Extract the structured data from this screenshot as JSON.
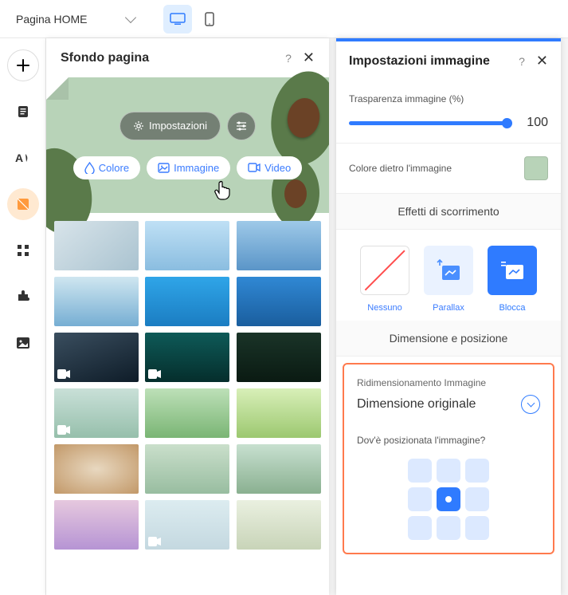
{
  "topbar": {
    "page_name": "Pagina HOME"
  },
  "bg_panel": {
    "title": "Sfondo pagina",
    "settings_btn": "Impostazioni",
    "tabs": {
      "color": "Colore",
      "image": "Immagine",
      "video": "Video"
    }
  },
  "settings_panel": {
    "title": "Impostazioni immagine",
    "transparency_label": "Trasparenza immagine (%)",
    "transparency_value": "100",
    "color_behind_label": "Colore dietro l'immagine",
    "color_behind": "#b8d3b8",
    "scroll_title": "Effetti di scorrimento",
    "scroll_options": {
      "none": "Nessuno",
      "parallax": "Parallax",
      "block": "Blocca"
    },
    "size_pos_title": "Dimensione e posizione",
    "resize_label": "Ridimensionamento Immagine",
    "resize_value": "Dimensione originale",
    "position_label": "Dov'è posizionata l'immagine?",
    "selected_position": "center"
  },
  "thumbnails": [
    {
      "bg": "linear-gradient(140deg,#d8e4ea,#aac3d0)"
    },
    {
      "bg": "linear-gradient(#bfe0f5,#8abde0)"
    },
    {
      "bg": "linear-gradient(180deg,#9ec9e8,#5a95c8)"
    },
    {
      "bg": "linear-gradient(#cfe6f0,#76aed3)"
    },
    {
      "bg": "linear-gradient(#2fa5e8,#1b7dc2)"
    },
    {
      "bg": "linear-gradient(#3088d4,#1a5e9e)"
    },
    {
      "bg": "linear-gradient(160deg,#3a4e5f,#0e1c28)",
      "video": true
    },
    {
      "bg": "linear-gradient(#0e5a58,#052e2c)",
      "video": true
    },
    {
      "bg": "linear-gradient(#1a3428,#0a1a12)"
    },
    {
      "bg": "linear-gradient(#c9e0d8,#96bfab)",
      "video": true
    },
    {
      "bg": "linear-gradient(#bde0b8,#7ab574)"
    },
    {
      "bg": "linear-gradient(#d8efb8,#9cc870)"
    },
    {
      "bg": "radial-gradient(#e8d8c0,#c29868)"
    },
    {
      "bg": "linear-gradient(#cadfcb,#98bda0)"
    },
    {
      "bg": "linear-gradient(#c8e0d0,#8ab090)"
    },
    {
      "bg": "linear-gradient(#e6c8de,#b694d4)"
    },
    {
      "bg": "linear-gradient(#dcecf0,#c4d8e0)",
      "video": true
    },
    {
      "bg": "linear-gradient(#eaf0e0,#c8d4b8)"
    }
  ]
}
